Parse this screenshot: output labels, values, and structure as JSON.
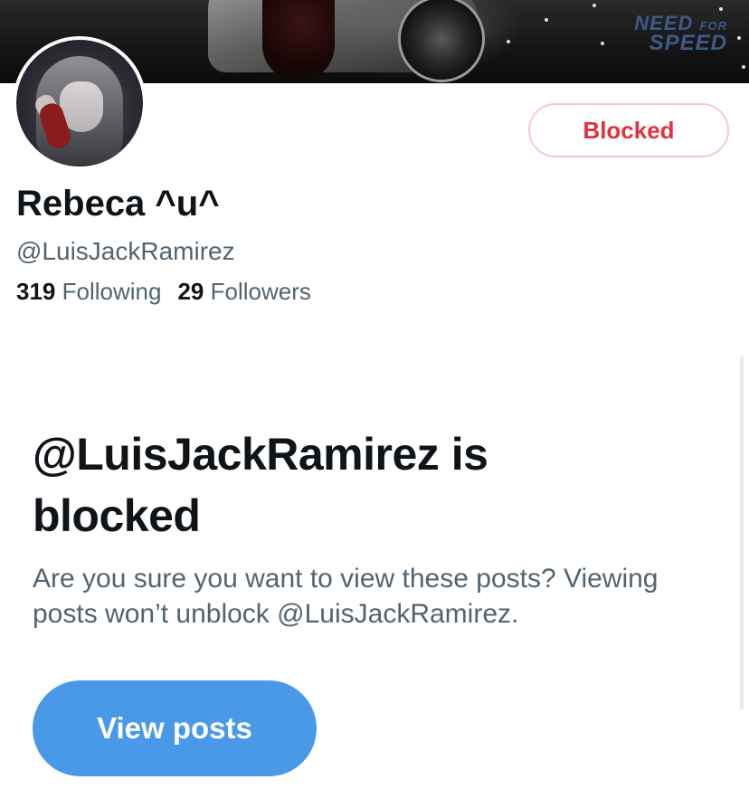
{
  "banner": {
    "logo_line1": "NEED",
    "logo_line1_small": "FOR",
    "logo_line2": "SPEED"
  },
  "profile": {
    "display_name": "Rebeca ^u^",
    "handle": "@LuisJackRamirez",
    "following_count": "319",
    "following_label": "Following",
    "followers_count": "29",
    "followers_label": "Followers"
  },
  "actions": {
    "blocked_label": "Blocked"
  },
  "blocked_notice": {
    "title": "@LuisJackRamirez is blocked",
    "description": "Are you sure you want to view these posts? Viewing posts won’t unblock @LuisJackRamirez.",
    "view_posts_label": "View posts"
  },
  "colors": {
    "blocked_text": "#e0323f",
    "blocked_border": "#f4c9cd",
    "primary_button": "#4a99e9",
    "secondary_text": "#536471",
    "primary_text": "#0f1419"
  }
}
